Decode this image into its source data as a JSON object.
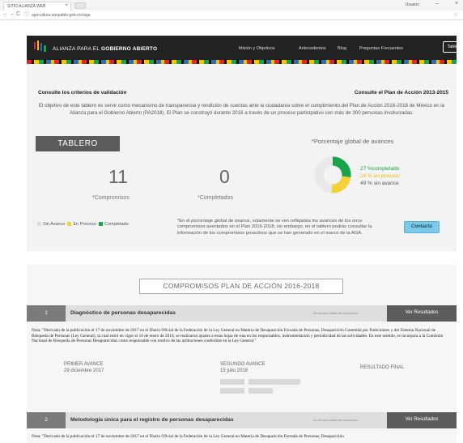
{
  "browser": {
    "tab_title": "SITIO ALIANZA WEB",
    "tab_close": "×",
    "window_user": "Usuario",
    "win_min": "–",
    "win_close": "×",
    "back": "←",
    "forward": "→",
    "reload": "C",
    "url": "agricultura.sanpablo.gob.mx/aga",
    "star": "☆"
  },
  "header": {
    "brand_light": "ALIANZA PARA EL",
    "brand_bold": "GOBIERNO ABIERTO",
    "nav": [
      "Misión y Objetivos",
      "Antecedentes",
      "Blog",
      "Preguntas Frecuentes"
    ],
    "nav_button": "Tablero"
  },
  "dashboard": {
    "left_heading": "Consulte los criterios de validación",
    "right_heading": "Consulte el Plan de Acción 2013-2015",
    "intro": "El objetivo de este tablero es servir como mecanismo de transparencia y rendición de cuentas ante la ciudadanía sobre el cumplimiento del Plan de Acción 2016-2018 de México en la Alianza para el Gobierno Abierto (PA2018). El Plan se construyó durante 2016 a través de un proceso participativo con más de 300 personas involucradas.",
    "tablero_label": "TABLERO",
    "compromisos_value": "11",
    "compromisos_label": "*Compromisos",
    "completados_value": "0",
    "completados_label": "*Completados",
    "pct_title": "*Porcentaje global de avances",
    "legend_completed": "27 %completado",
    "legend_in_progress": "24 % en proceso",
    "legend_no_progress": "49 % sin avance",
    "key_sin_avance": "Sin Avance",
    "key_en_proceso": "En Proceso",
    "key_completado": "Completado",
    "note": "*En el porcentaje global de avance, solamente se ven reflejados los avances de los once compromisos asentados en el Plan 2016-2018, sin embargo, en el tablero podrás consultar la información de los compromisos proactivos que se han generado en el marco de la AGA.",
    "contact_button": "Contacto",
    "colors": {
      "completed": "#1aa349",
      "in_progress": "#f4d23a",
      "no_progress": "#e9e9e9"
    }
  },
  "donut": {
    "completed": 27,
    "in_progress": 24,
    "no_progress": 49
  },
  "commitments": {
    "panel_title": "COMPROMISOS PLAN DE ACCIÓN 2016-2018",
    "items": [
      {
        "number": "1",
        "title": "Diagnóstico de personas desaparecidas",
        "hint": "Da clic para detalle del compromiso",
        "button": "Ver Resultados",
        "note": "Nota: \"Derivado de la publicación el 17 de noviembre de 2017 en el Diario Oficial de la Federación de la Ley General en Materia de Desaparición Forzada de Personas, Desaparición Cometida por Particulares y del Sistema Nacional de Búsqueda de Personas (Ley General), la cual entró en vigor el 16 de enero de 2018, se realizaron ajustes a estas hojas de ruta en los responsables, instrumentación y periodicidad de las actividades. En este sentido, se incorpora a la Comisión Nacional de Búsqueda de Personas Desaparecidas como responsable con motivo de las atribuciones conferidas en la Ley General.\"",
        "first_label": "PRIMER AVANCE",
        "first_date": "29 diciembre 2017",
        "second_label": "SEGUNDO AVANCE",
        "second_date": "15 julio 2018",
        "final_label": "RESULTADO FINAL"
      },
      {
        "number": "2",
        "title": "Metodología única para el registro de personas desaparecidas",
        "hint": "Da clic para detalle del compromiso",
        "button": "Ver Resultados",
        "note": "Nota: \"Derivado de la publicación el 17 de noviembre de 2017 en el Diario Oficial de la Federación de la Ley General en Materia de Desaparición Forzada de Personas, Desaparición"
      }
    ]
  }
}
